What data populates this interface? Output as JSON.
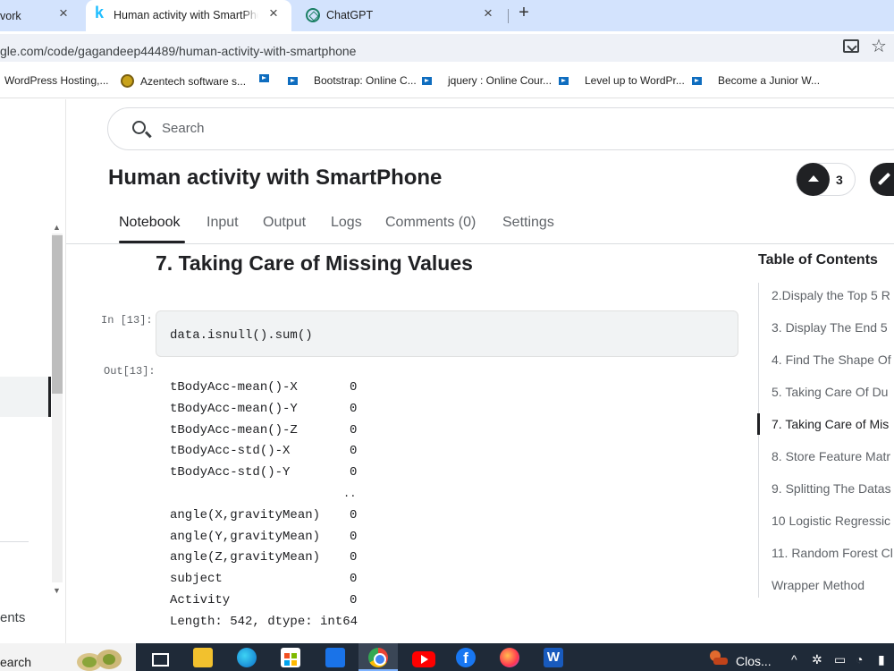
{
  "browser": {
    "tabs": [
      {
        "title": "vork",
        "close": "×"
      },
      {
        "title": "Human activity with SmartPhone",
        "close": "×",
        "favicon": "k"
      },
      {
        "title": "ChatGPT",
        "close": "×"
      }
    ],
    "new_tab": "+",
    "url": "gle.com/code/gagandeep44489/human-activity-with-smartphone"
  },
  "bookmarks": [
    {
      "label": "WordPress Hosting,...",
      "icon": "none"
    },
    {
      "label": "Azentech software s...",
      "icon": "azentech-icon"
    },
    {
      "label": "",
      "icon": "udemy-icon"
    },
    {
      "label": "Bootstrap: Online C...",
      "icon": "udemy-icon"
    },
    {
      "label": "jquery : Online Cour...",
      "icon": "udemy-icon"
    },
    {
      "label": "Level up to WordPr...",
      "icon": "udemy-icon"
    },
    {
      "label": "Become a Junior W...",
      "icon": "udemy-icon"
    }
  ],
  "leftnav": {
    "partial_label": "ents"
  },
  "search": {
    "placeholder": "Search"
  },
  "notebook": {
    "title": "Human activity with SmartPhone",
    "votes": "3",
    "tabs": [
      "Notebook",
      "Input",
      "Output",
      "Logs",
      "Comments (0)",
      "Settings"
    ],
    "active_tab": "Notebook"
  },
  "cell": {
    "heading": "7. Taking Care of Missing Values",
    "in_prompt": "In [13]:",
    "code": "data.isnull().sum()",
    "out_prompt": "Out[13]:",
    "output_rows": [
      {
        "name": "tBodyAcc-mean()-X",
        "value": "0"
      },
      {
        "name": "tBodyAcc-mean()-Y",
        "value": "0"
      },
      {
        "name": "tBodyAcc-mean()-Z",
        "value": "0"
      },
      {
        "name": "tBodyAcc-std()-X",
        "value": "0"
      },
      {
        "name": "tBodyAcc-std()-Y",
        "value": "0"
      },
      {
        "name": "angle(X,gravityMean)",
        "value": "0"
      },
      {
        "name": "angle(Y,gravityMean)",
        "value": "0"
      },
      {
        "name": "angle(Z,gravityMean)",
        "value": "0"
      },
      {
        "name": "subject",
        "value": "0"
      },
      {
        "name": "Activity",
        "value": "0"
      }
    ],
    "ellipsis": "..",
    "length_line": "Length: 542, dtype: int64"
  },
  "toc": {
    "title": "Table of Contents",
    "items": [
      "2.Dispaly the Top 5 R",
      "3. Display The End 5",
      "4. Find The Shape Of",
      "5. Taking Care Of Du",
      "7. Taking Care of Mis",
      "8. Store Feature Matr",
      "9. Splitting The Datas",
      "10 Logistic Regressic",
      "11. Random Forest Cl",
      "Wrapper Method"
    ],
    "active_index": 4
  },
  "taskbar": {
    "search_text": "earch",
    "weather_text": "Clos...",
    "facebook_glyph": "f",
    "word_glyph": "W"
  }
}
